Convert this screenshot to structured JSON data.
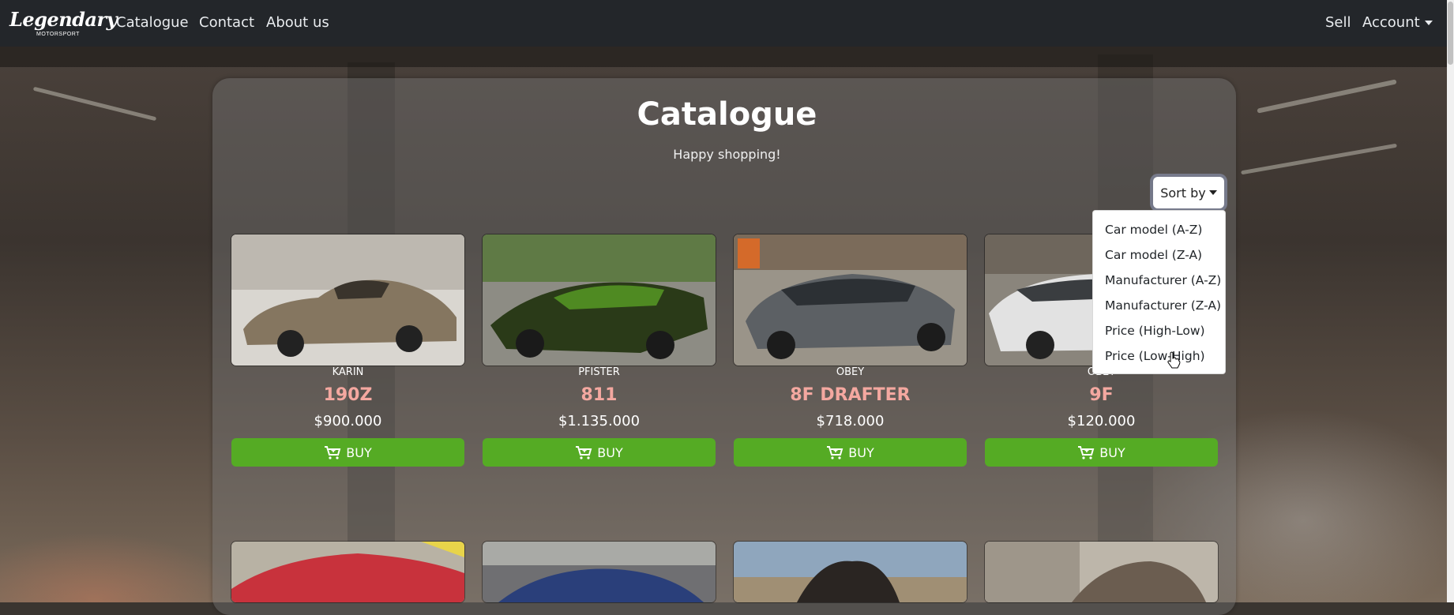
{
  "navbar": {
    "brand_script": "Legendary",
    "brand_sub": "MOTORSPORT",
    "links": [
      "Catalogue",
      "Contact",
      "About us"
    ],
    "sell": "Sell",
    "account": "Account"
  },
  "page": {
    "title": "Catalogue",
    "subtitle": "Happy shopping!"
  },
  "sort": {
    "label": "Sort by",
    "options": [
      "Car model (A-Z)",
      "Car model (Z-A)",
      "Manufacturer (A-Z)",
      "Manufacturer (Z-A)",
      "Price (High-Low)",
      "Price (Low-High)"
    ]
  },
  "cars": [
    {
      "maker": "KARIN",
      "model": "190Z",
      "price": "$900.000",
      "buy": "BUY",
      "color": "#8a7a62"
    },
    {
      "maker": "PFISTER",
      "model": "811",
      "price": "$1.135.000",
      "buy": "BUY",
      "color": "#3f6e1d"
    },
    {
      "maker": "OBEY",
      "model": "8F DRAFTER",
      "price": "$718.000",
      "buy": "BUY",
      "color": "#5e6266"
    },
    {
      "maker": "OBEY",
      "model": "9F",
      "price": "$120.000",
      "buy": "BUY",
      "color": "#d8d8d8"
    }
  ],
  "next_row_colors": [
    "#c8323c",
    "#2a3f7a",
    "#7a8a99",
    "#6b5d50"
  ],
  "colors": {
    "navbar": "#23262a",
    "buy_button": "#55ab24",
    "model_text": "#f4a8a0"
  }
}
